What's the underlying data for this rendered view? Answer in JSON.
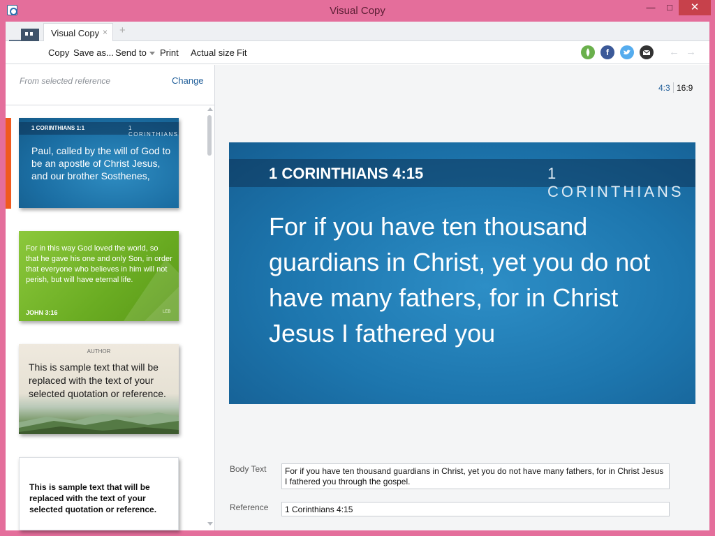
{
  "window": {
    "title": "Visual Copy",
    "min_glyph": "—",
    "max_glyph": "□",
    "close_glyph": "✕"
  },
  "tabs": [
    {
      "label": "Visual Copy",
      "close_glyph": "×"
    }
  ],
  "tab_add_glyph": "+",
  "toolbar": {
    "copy": "Copy",
    "save_as": "Save as...",
    "send_to": "Send to",
    "print": "Print",
    "actual_size": "Actual size",
    "fit": "Fit",
    "share_icons": [
      "faithlife-icon",
      "facebook-icon",
      "twitter-icon",
      "email-icon"
    ],
    "share_colors": {
      "faithlife": "#6ab04c",
      "facebook": "#3b5998",
      "twitter": "#55acee",
      "email": "#333333"
    },
    "back_glyph": "←",
    "forward_glyph": "→"
  },
  "left_panel": {
    "from_label": "From selected reference",
    "change_label": "Change",
    "selected_accent": "#f05a1e",
    "thumbnails": [
      {
        "reference": "1 CORINTHIANS 1:1",
        "book": "1 CORINTHIANS",
        "text": "Paul, called by the will of God to be an apostle of Christ Jesus, and our brother Sosthenes,"
      },
      {
        "text": "For in this way God loved the world, so that he gave his one and only Son, in order that everyone who believes in him will not perish, but will have eternal life.",
        "reference": "JOHN 3:16",
        "version": "LEB"
      },
      {
        "author": "AUTHOR",
        "text": "This is sample text that will be replaced with the text of your selected quotation or reference."
      },
      {
        "text": "This is sample text that will be replaced with the text of your selected quotation or reference."
      }
    ]
  },
  "right_panel": {
    "ratio_4_3": "4:3",
    "ratio_16_9": "16:9",
    "preview": {
      "reference": "1 CORINTHIANS 4:15",
      "book": "1 CORINTHIANS",
      "text": "For if you have ten thousand guardians in Christ, yet you do not have many fathers, for in Christ Jesus I fathered you"
    },
    "body_text_label": "Body Text",
    "body_text_value": "For if you have ten thousand guardians in Christ, yet you do not have many fathers, for in Christ Jesus I fathered you through the gospel.",
    "reference_label": "Reference",
    "reference_value": "1 Corinthians 4:15"
  }
}
